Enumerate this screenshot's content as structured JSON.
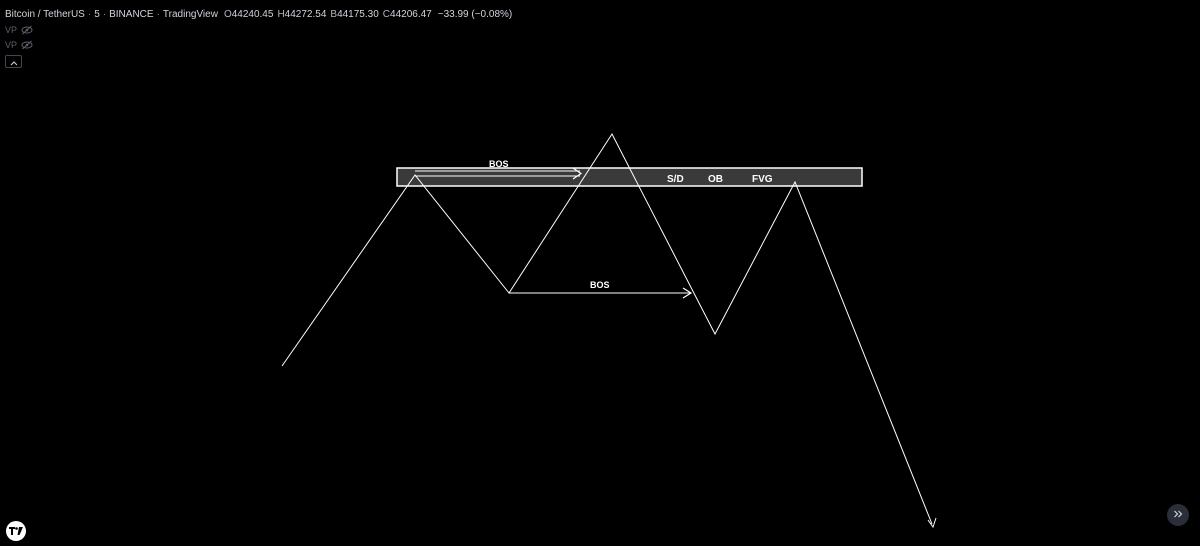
{
  "header": {
    "symbol": "Bitcoin / TetherUS",
    "interval": "5",
    "exchange": "BINANCE",
    "source": "TradingView",
    "ohlc": {
      "o_label": "O",
      "o_value": "44240.45",
      "h_label": "H",
      "h_value": "44272.54",
      "l_label": "B",
      "l_value": "44175.30",
      "c_label": "C",
      "c_value": "44206.47",
      "change": "−33.99 (−0.08%)"
    },
    "separator": "·"
  },
  "studies": [
    {
      "label": "VP",
      "icon": "eye-off-icon"
    },
    {
      "label": "VP",
      "icon": "eye-off-icon"
    }
  ],
  "collapse_icon": "chevron-up-icon",
  "drawing": {
    "zone_labels": [
      "S/D",
      "OB",
      "FVG"
    ],
    "bos_label_1": "BOS",
    "bos_label_2": "BOS"
  },
  "colors": {
    "background": "#000000",
    "line": "#ffffff",
    "zone_fill": "#3a3a3a",
    "zone_border": "#ffffff"
  },
  "footer": {
    "logo_icon": "tradingview-logo-icon",
    "scroll_icon": "double-chevron-right-icon"
  }
}
